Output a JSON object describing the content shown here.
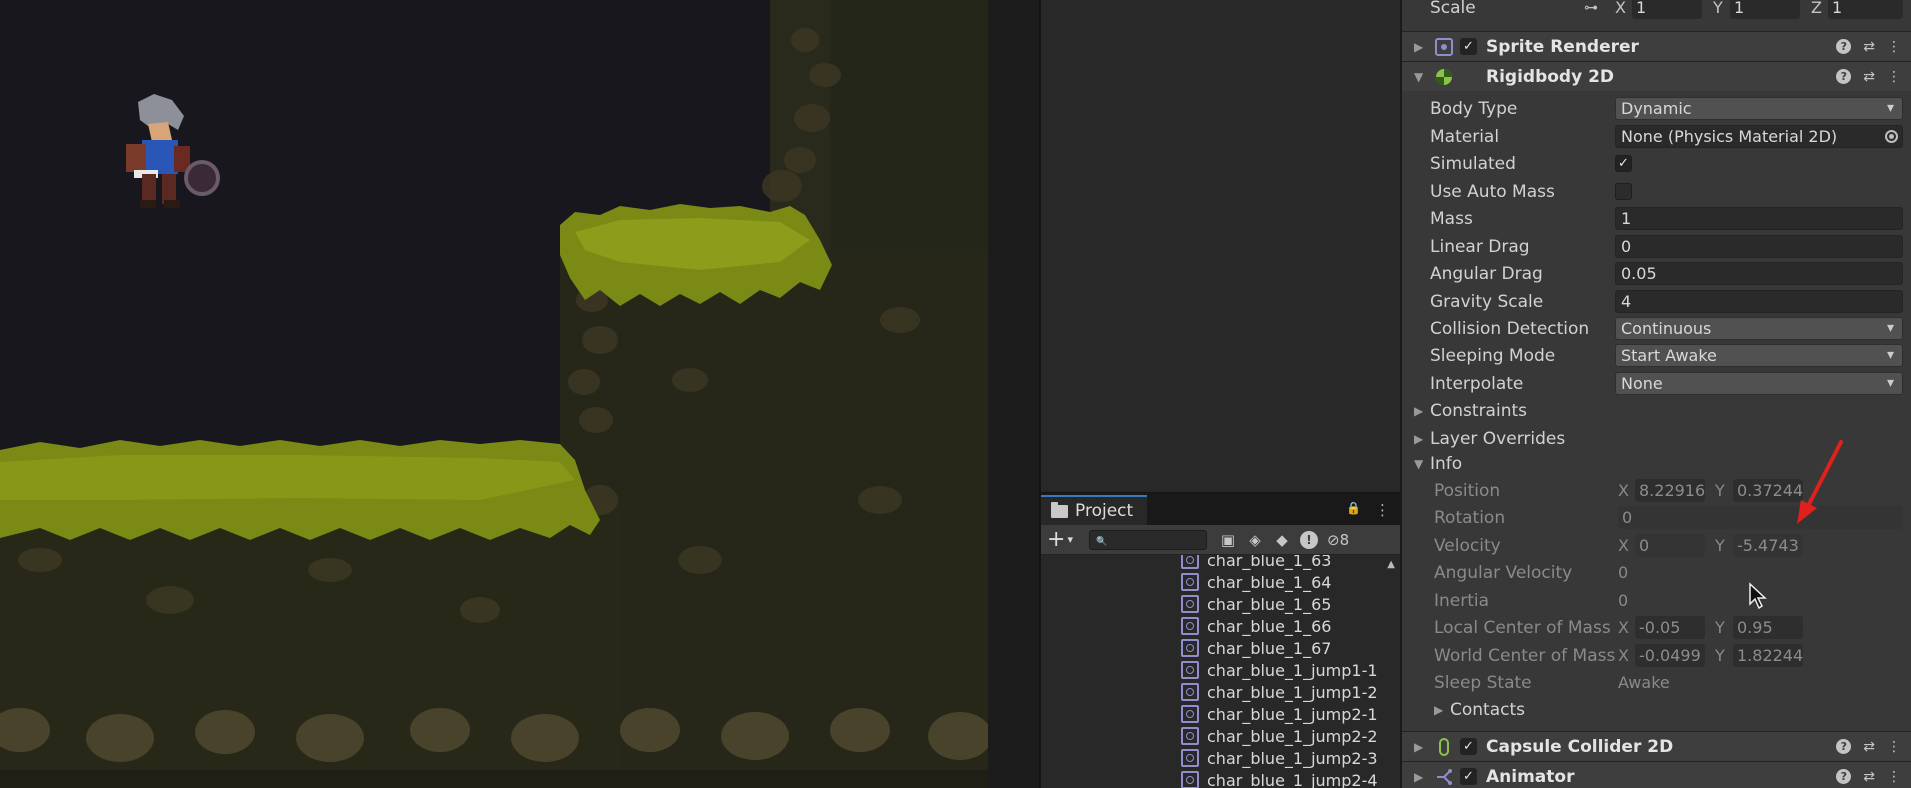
{
  "inspector": {
    "scale": {
      "label": "Scale",
      "x_label": "X",
      "x": "1",
      "y_label": "Y",
      "y": "1",
      "z_label": "Z",
      "z": "1"
    },
    "sprite_renderer": {
      "name": "Sprite Renderer",
      "checked": "✓"
    },
    "rigidbody": {
      "name": "Rigidbody 2D",
      "body_type": {
        "label": "Body Type",
        "value": "Dynamic"
      },
      "material": {
        "label": "Material",
        "value": "None (Physics Material 2D)"
      },
      "simulated": {
        "label": "Simulated",
        "check": "✓"
      },
      "use_auto_mass": {
        "label": "Use Auto Mass"
      },
      "mass": {
        "label": "Mass",
        "value": "1"
      },
      "linear_drag": {
        "label": "Linear Drag",
        "value": "0"
      },
      "angular_drag": {
        "label": "Angular Drag",
        "value": "0.05"
      },
      "gravity_scale": {
        "label": "Gravity Scale",
        "value": "4"
      },
      "collision_detection": {
        "label": "Collision Detection",
        "value": "Continuous"
      },
      "sleeping_mode": {
        "label": "Sleeping Mode",
        "value": "Start Awake"
      },
      "interpolate": {
        "label": "Interpolate",
        "value": "None"
      },
      "constraints": {
        "label": "Constraints"
      },
      "layer_overrides": {
        "label": "Layer Overrides"
      },
      "info": {
        "label": "Info",
        "position": {
          "label": "Position",
          "x_label": "X",
          "x": "8.229166",
          "y_label": "Y",
          "y": "0.37244"
        },
        "rotation": {
          "label": "Rotation",
          "value": "0"
        },
        "velocity": {
          "label": "Velocity",
          "x_label": "X",
          "x": "0",
          "y_label": "Y",
          "y": "-5.4743"
        },
        "angular_velocity": {
          "label": "Angular Velocity",
          "value": "0"
        },
        "inertia": {
          "label": "Inertia",
          "value": "0"
        },
        "local_com": {
          "label": "Local Center of Mass",
          "x_label": "X",
          "x": "-0.05",
          "y_label": "Y",
          "y": "0.95"
        },
        "world_com": {
          "label": "World Center of Mass",
          "x_label": "X",
          "x": "-0.0499",
          "y_label": "Y",
          "y": "1.82244"
        },
        "sleep_state": {
          "label": "Sleep State",
          "value": "Awake"
        },
        "contacts": {
          "label": "Contacts"
        }
      }
    },
    "capsule_collider": {
      "name": "Capsule Collider 2D",
      "checked": "✓"
    },
    "animator": {
      "name": "Animator",
      "checked": "✓"
    },
    "help_glyph": "?",
    "preset_glyph": "⇄",
    "menu_glyph": "⋮"
  },
  "project": {
    "tab_label": "Project",
    "hidden_count": "8",
    "lock_glyph": "🔒",
    "menu_glyph": "⋮",
    "add_glyph": "+",
    "add_caret": "▾",
    "search_glyph": "🔍",
    "items": [
      "char_blue_1_63",
      "char_blue_1_64",
      "char_blue_1_65",
      "char_blue_1_66",
      "char_blue_1_67",
      "char_blue_1_jump1-1",
      "char_blue_1_jump1-2",
      "char_blue_1_jump2-1",
      "char_blue_1_jump2-2",
      "char_blue_1_jump2-3",
      "char_blue_1_jump2-4"
    ]
  },
  "colors": {
    "game_bg": "#18171d",
    "grass": "#7a8a14",
    "rock": "#2b2a1a",
    "annotation_arrow": "#e0201c",
    "tab_accent": "#3a79bb"
  }
}
